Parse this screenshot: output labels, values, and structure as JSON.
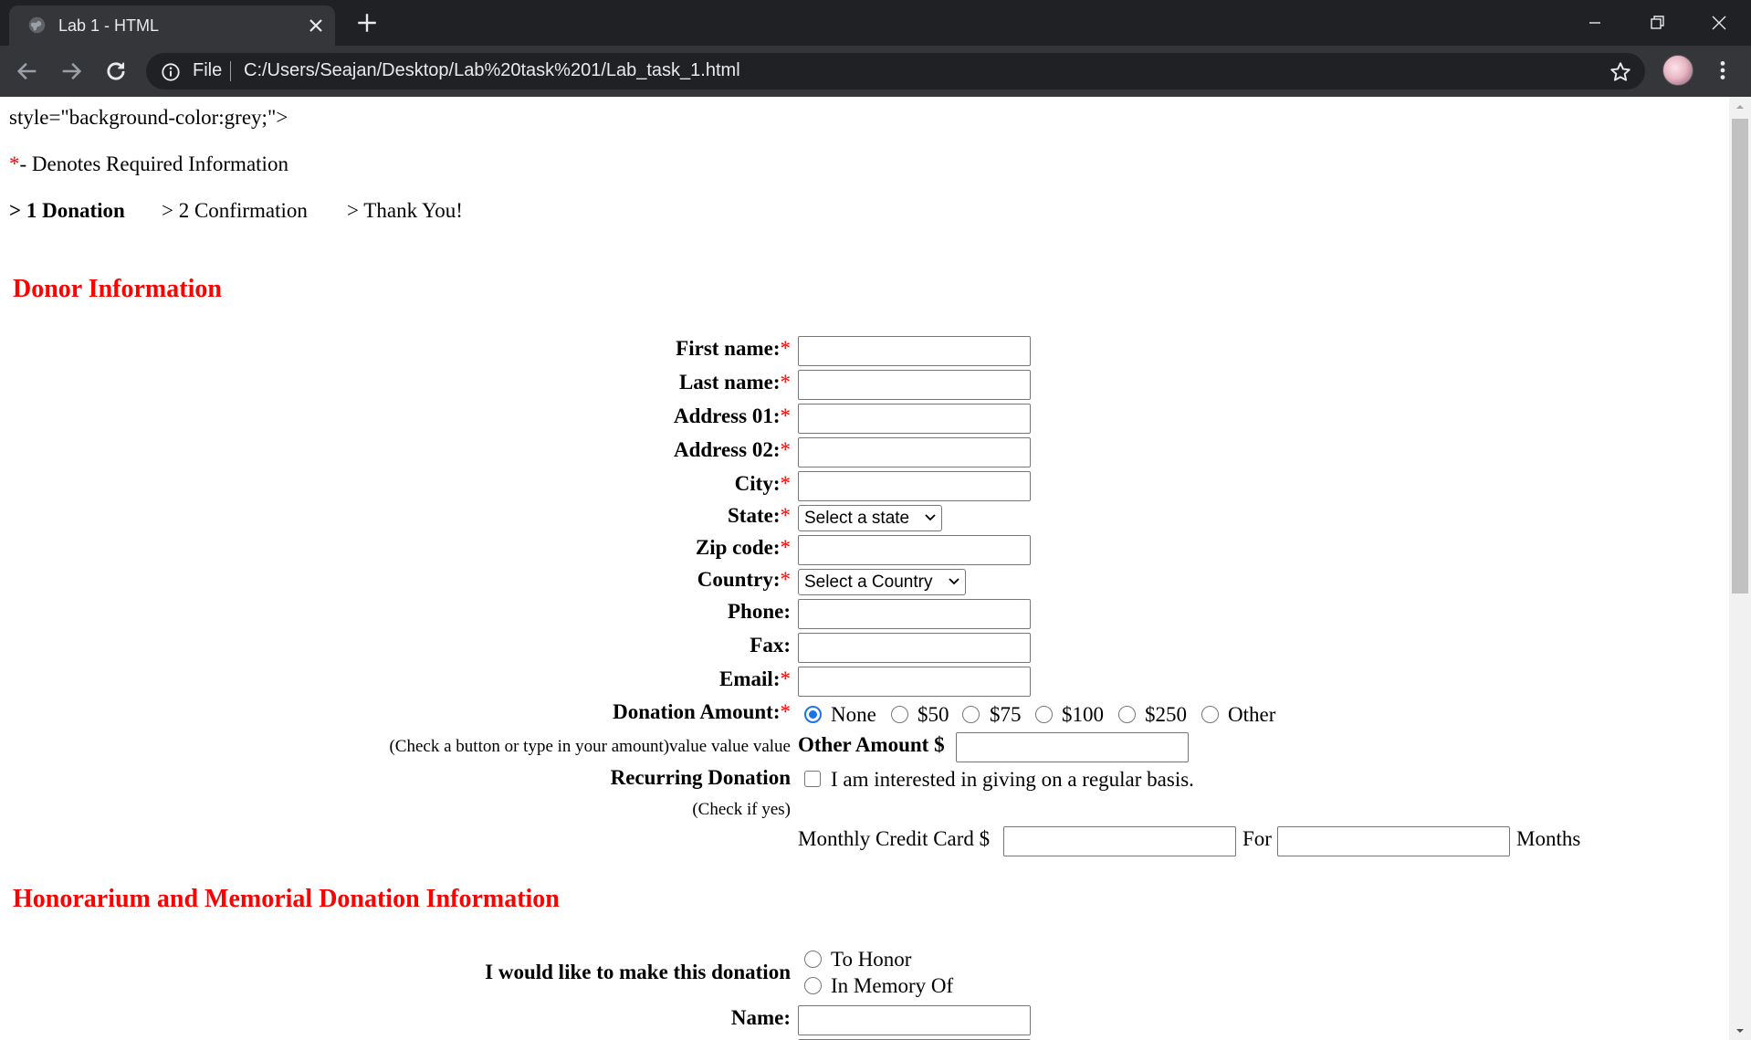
{
  "browser": {
    "tab_title": "Lab 1 - HTML",
    "omnibox_scheme": "File",
    "url": "C:/Users/Seajan/Desktop/Lab%20task%201/Lab_task_1.html"
  },
  "page": {
    "stray_text": "style=\"background-color:grey;\">",
    "required_note": {
      "asterisk": "*",
      "text": "- Denotes Required Information"
    },
    "steps": [
      "> 1 Donation",
      "> 2 Confirmation",
      "> Thank You!"
    ],
    "donor_heading": "Donor Information",
    "fields": {
      "first_name": {
        "label": "First name:",
        "required": "*"
      },
      "last_name": {
        "label": "Last name:",
        "required": "*"
      },
      "address1": {
        "label": "Address 01:",
        "required": "*"
      },
      "address2": {
        "label": "Address 02:",
        "required": "*"
      },
      "city": {
        "label": "City:",
        "required": "*"
      },
      "state": {
        "label": "State:",
        "required": "*",
        "selected": "Select a state"
      },
      "zip": {
        "label": "Zip code:",
        "required": "*"
      },
      "country": {
        "label": "Country:",
        "required": "*",
        "selected": "Select a Country"
      },
      "phone": {
        "label": "Phone:"
      },
      "fax": {
        "label": "Fax:"
      },
      "email": {
        "label": "Email:",
        "required": "*"
      }
    },
    "donation": {
      "label": "Donation Amount:",
      "required": "*",
      "options": [
        "None",
        "$50",
        "$75",
        "$100",
        "$250",
        "Other"
      ],
      "selected": "None",
      "hint": "(Check a button or type in your amount)value value value",
      "other_amount_label": "Other Amount $"
    },
    "recurring": {
      "label": "Recurring Donation",
      "checkbox_text": "I am interested in giving on a regular basis.",
      "hint": "(Check if yes)",
      "monthly_label": "Monthly Credit Card $",
      "for_label": "For",
      "months_label": "Months"
    },
    "honorarium_heading": "Honorarium and Memorial Donation Information",
    "honor": {
      "label": "I would like to make this donation",
      "options": [
        "To Honor",
        "In Memory Of"
      ]
    },
    "name_label": "Name:"
  }
}
